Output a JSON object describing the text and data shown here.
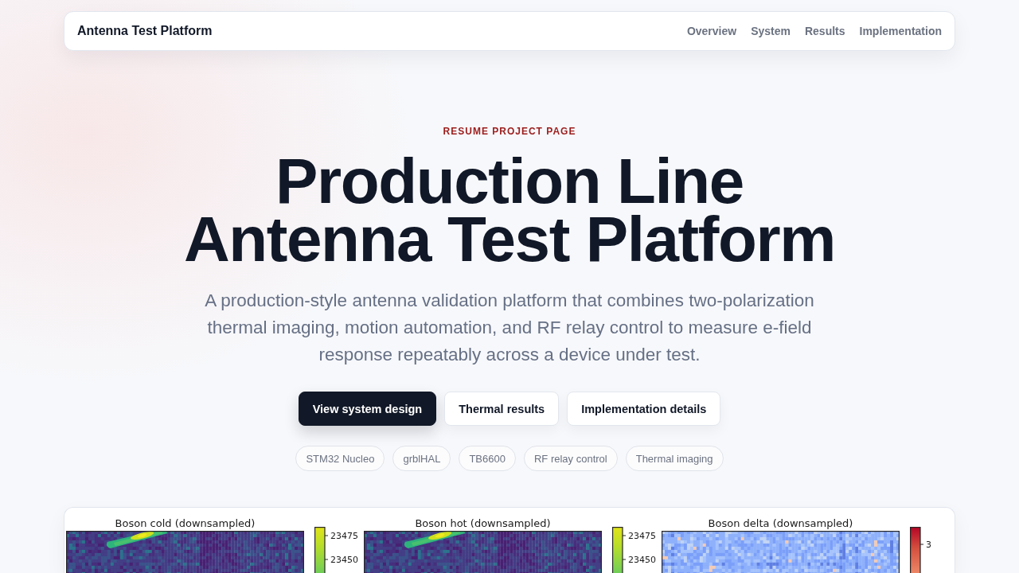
{
  "header": {
    "brand": "Antenna Test Platform",
    "nav": [
      {
        "label": "Overview"
      },
      {
        "label": "System"
      },
      {
        "label": "Results"
      },
      {
        "label": "Implementation"
      }
    ]
  },
  "hero": {
    "eyebrow": "RESUME PROJECT PAGE",
    "title": "Production Line Antenna Test Platform",
    "subtitle": "A production-style antenna validation platform that combines two-polarization thermal imaging, motion automation, and RF relay control to measure e-field response repeatably across a device under test.",
    "buttons": [
      {
        "label": "View system design",
        "kind": "primary"
      },
      {
        "label": "Thermal results",
        "kind": "secondary"
      },
      {
        "label": "Implementation details",
        "kind": "secondary"
      }
    ],
    "tags": [
      "STM32 Nucleo",
      "grblHAL",
      "TB6600",
      "RF relay control",
      "Thermal imaging"
    ]
  },
  "figure": {
    "panels": [
      {
        "title": "Boson cold (downsampled)",
        "kind": "viridis",
        "colorbar_ticks": [
          "23475",
          "23450"
        ]
      },
      {
        "title": "Boson hot (downsampled)",
        "kind": "viridis",
        "colorbar_ticks": [
          "23475",
          "23450"
        ]
      },
      {
        "title": "Boson delta (downsampled)",
        "kind": "coolwarm",
        "colorbar_ticks": [
          "3"
        ]
      }
    ]
  }
}
